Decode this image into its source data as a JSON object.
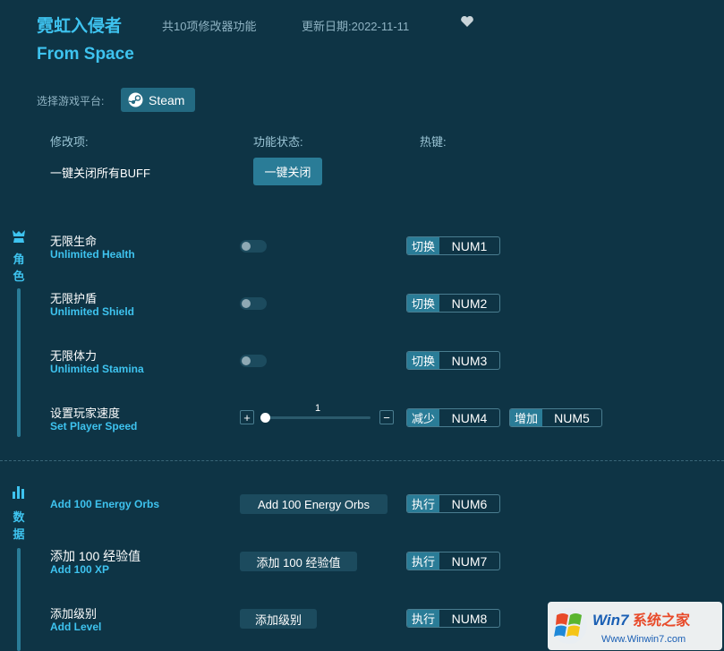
{
  "header": {
    "title_cn": "霓虹入侵者",
    "title_en": "From Space",
    "feature_count": "共10项修改器功能",
    "update_date": "更新日期:2022-11-11"
  },
  "platform": {
    "label": "选择游戏平台:",
    "steam": "Steam"
  },
  "columns": {
    "item": "修改项:",
    "status": "功能状态:",
    "hotkey": "热键:"
  },
  "global": {
    "label": "一键关闭所有BUFF",
    "button": "一键关闭"
  },
  "sections": [
    {
      "name": "角色",
      "chars": [
        "角",
        "色"
      ]
    },
    {
      "name": "数据",
      "chars": [
        "数",
        "据"
      ]
    }
  ],
  "rows": [
    {
      "cn": "无限生命",
      "en": "Unlimited Health",
      "toggle_on": false,
      "hk_label": "切换",
      "hk_key": "NUM1"
    },
    {
      "cn": "无限护盾",
      "en": "Unlimited Shield",
      "toggle_on": false,
      "hk_label": "切换",
      "hk_key": "NUM2"
    },
    {
      "cn": "无限体力",
      "en": "Unlimited Stamina",
      "toggle_on": false,
      "hk_label": "切换",
      "hk_key": "NUM3"
    },
    {
      "cn": "设置玩家速度",
      "en": "Set Player Speed",
      "slider_value": "1",
      "plus": "+",
      "minus": "−",
      "hk_label": "减少",
      "hk_key": "NUM4",
      "hk2_label": "增加",
      "hk2_key": "NUM5"
    },
    {
      "cn": "",
      "en": "Add 100 Energy Orbs",
      "action": "Add 100 Energy Orbs",
      "hk_label": "执行",
      "hk_key": "NUM6"
    },
    {
      "cn": "添加 100 经验值",
      "en": "Add 100 XP",
      "action": "添加 100 经验值",
      "hk_label": "执行",
      "hk_key": "NUM7"
    },
    {
      "cn": "添加级别",
      "en": "Add Level",
      "action": "添加级别",
      "hk_label": "执行",
      "hk_key": "NUM8"
    }
  ],
  "watermark": {
    "brand": "Win7系统之家",
    "url": "Www.Winwin7.com"
  },
  "colors": {
    "accent": "#3ec3ef",
    "background": "#0e3445",
    "button": "#2a7c97"
  }
}
